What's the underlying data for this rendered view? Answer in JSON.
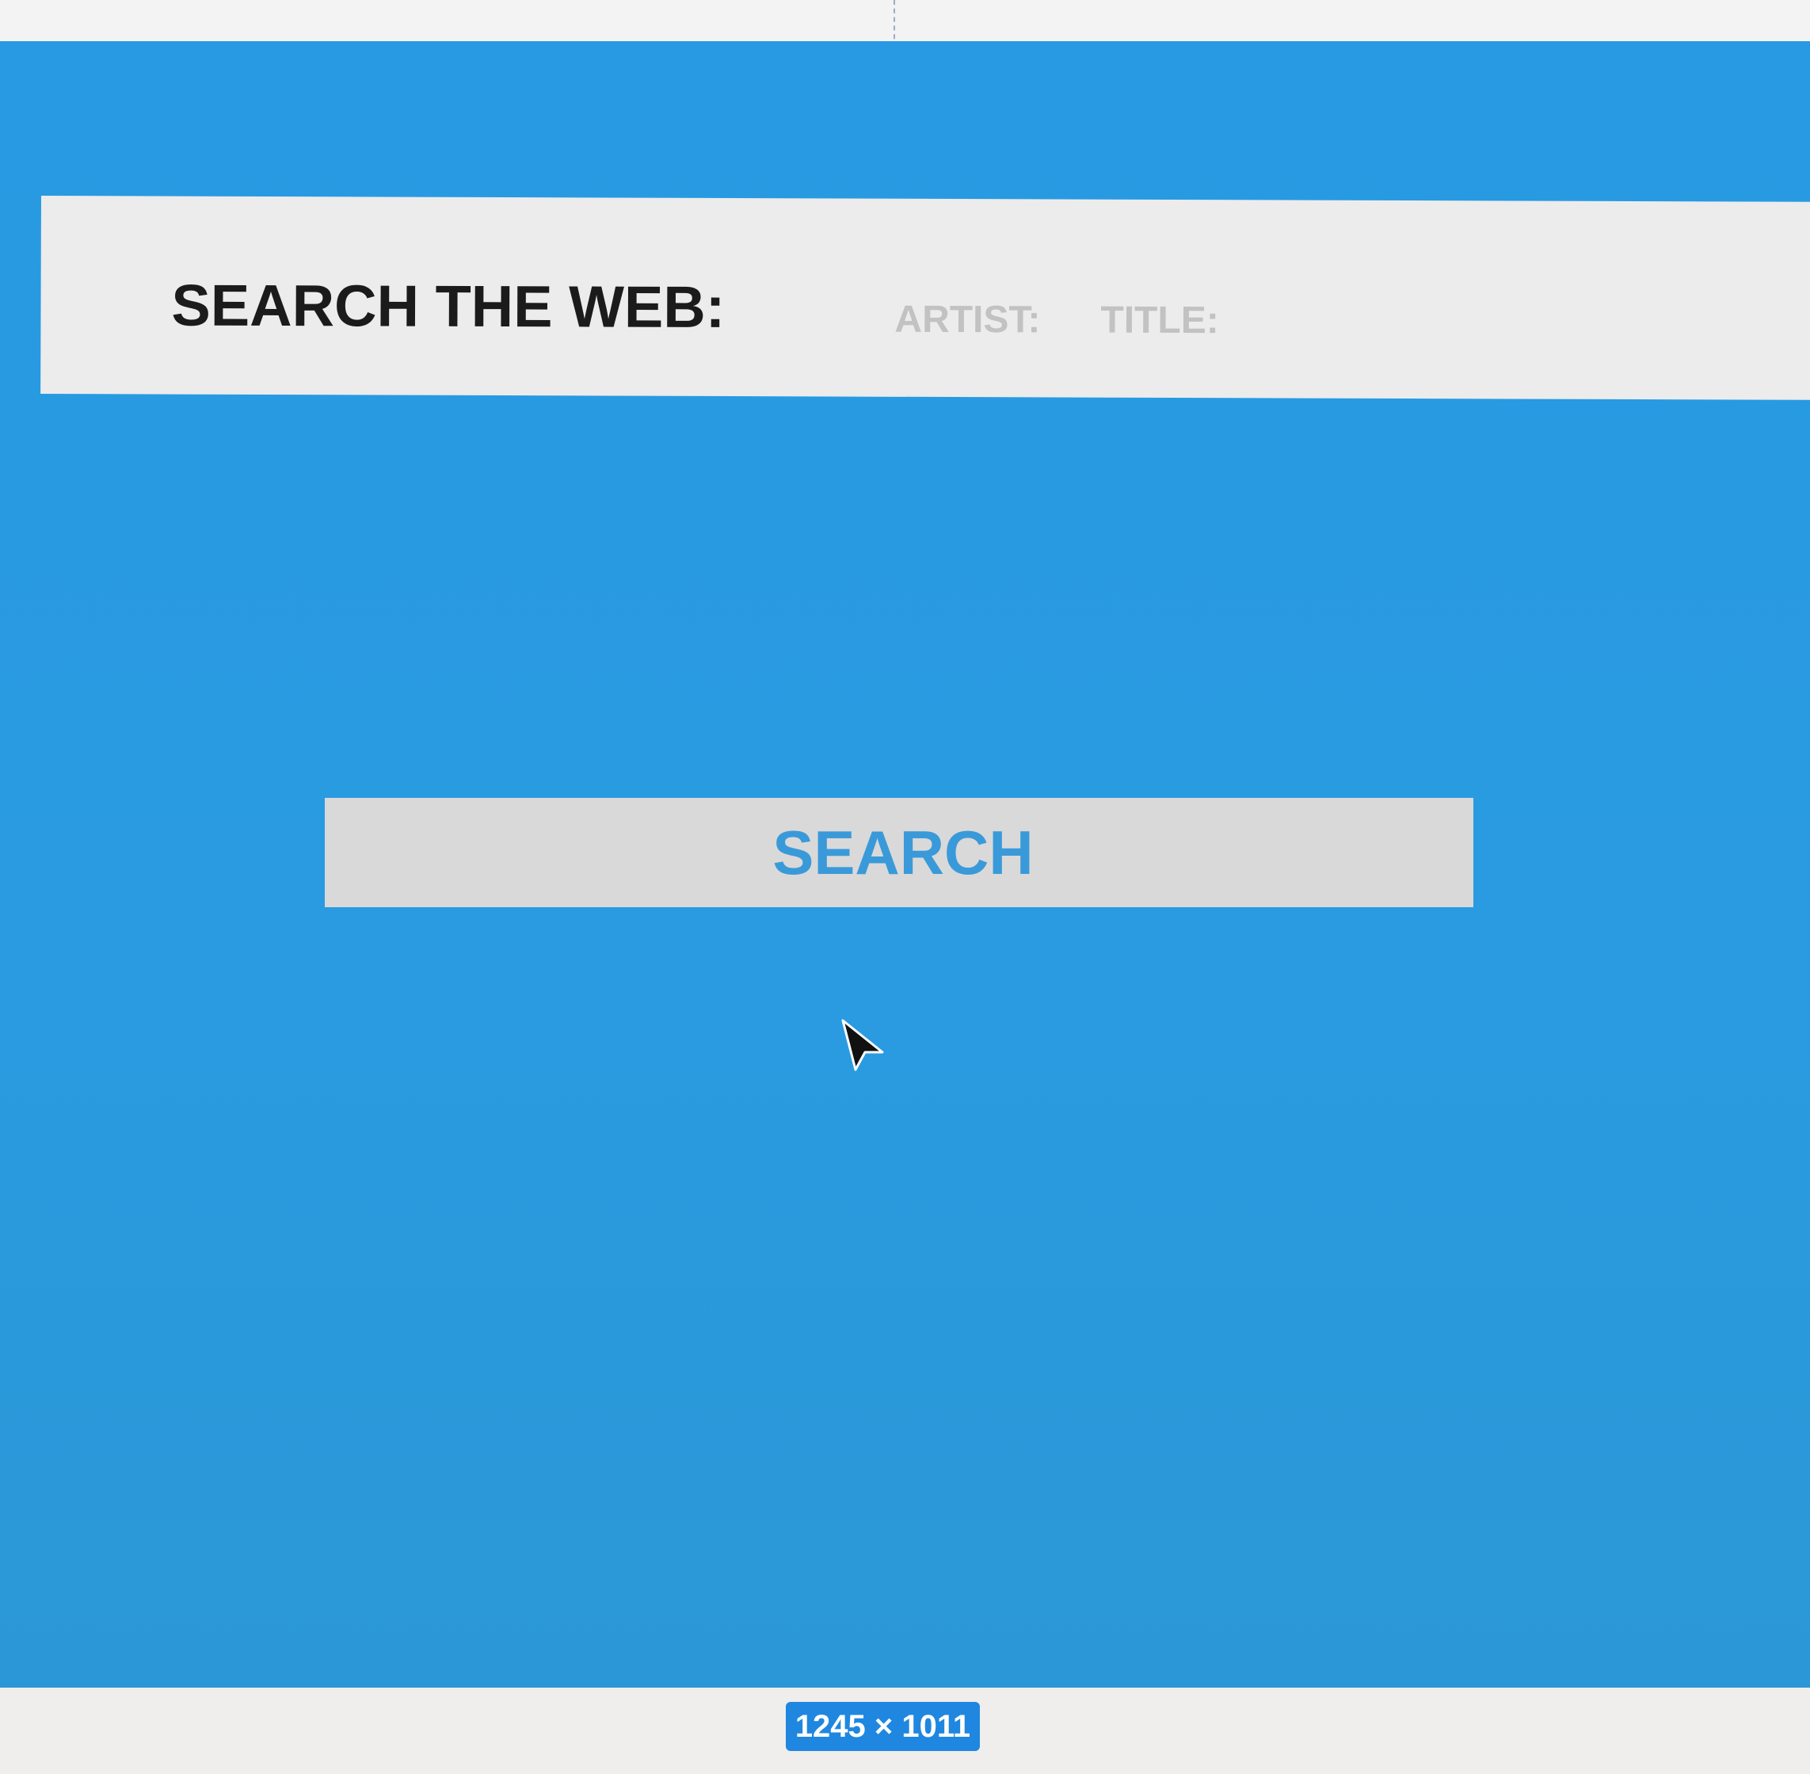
{
  "search_bar": {
    "label": "SEARCH THE WEB:",
    "artist_placeholder": "ARTIST:",
    "title_placeholder": "TITLE:"
  },
  "search_button": {
    "label": "SEARCH"
  },
  "status": {
    "dimensions": "1245 × 1011"
  },
  "icons": {
    "cursor": "mouse-pointer-icon"
  },
  "colors": {
    "background": "#2a9be0",
    "bar": "#ececec",
    "button": "#d9d9d9",
    "button_text": "#3a9ad9",
    "badge": "#1f87e0"
  }
}
